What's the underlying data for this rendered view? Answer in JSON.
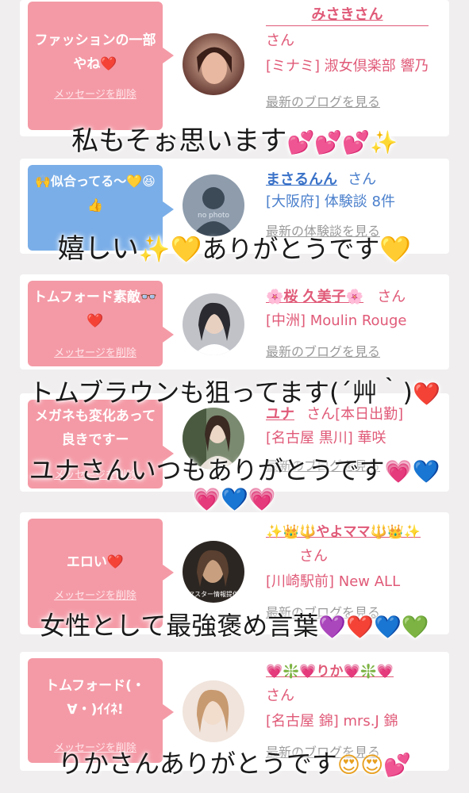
{
  "cards": [
    {
      "message": "ファッションの一部やね❤️",
      "delete_label": "メッセージを削除",
      "name": "みさきさん",
      "san": "さん",
      "shop": "[ミナミ] 淑女倶楽部 響乃",
      "blog": "最新のブログを見る",
      "avatar_colors": [
        "#6a3a30",
        "#d8a890"
      ]
    },
    {
      "message": "🙌似合ってる〜💛😆👍",
      "delete_label": "",
      "name": "まさるんん",
      "san": "さん",
      "shop": "[大阪府] 体験談 8件",
      "blog": "最新の体験談を見る",
      "avatar_text": "no photo",
      "avatar_colors": [
        "#3a4a5a",
        "#9aa8b8"
      ]
    },
    {
      "message": "トムフォード素敵👓❤️",
      "delete_label": "メッセージを削除",
      "name": "🌸桜 久美子🌸",
      "san": "さん",
      "shop": "[中洲] Moulin Rouge",
      "blog": "最新のブログを見る",
      "avatar_colors": [
        "#3a3a40",
        "#c8c8cc"
      ]
    },
    {
      "message": "メガネも変化あって良きですー",
      "delete_label": "メッセージを削除",
      "name": "ユナ",
      "san": "さん[本日出勤]",
      "shop": "[名古屋 黒川] 華咲",
      "blog": "最新のブログを見る",
      "avatar_colors": [
        "#4a5a40",
        "#d8c8b8"
      ]
    },
    {
      "message": "エロい❤️",
      "delete_label": "メッセージを削除",
      "name": "✨👑🔱やよママ🔱👑✨",
      "san": "さん",
      "shop": "[川崎駅前] New ALL",
      "blog": "最新のブログを見る",
      "avatar_text": "マスター情報提供",
      "avatar_colors": [
        "#2a2420",
        "#b89878"
      ]
    },
    {
      "message": "トムフォード(・∀・)ｲｲﾈ!",
      "delete_label": "メッセージを削除",
      "name": "💗❇️💗りか💗❇️💗",
      "san": "さん",
      "shop": "[名古屋 錦] mrs.J 錦",
      "blog": "最新のブログを見る",
      "avatar_colors": [
        "#c8a890",
        "#f0e0d8"
      ]
    }
  ],
  "overlays": [
    {
      "text": "私もそぉ思います",
      "emoji": "💕💕💕✨"
    },
    {
      "text": "嬉しい",
      "emoji": "✨💛ありがとうです💛"
    },
    {
      "text": "トムブラウンも狙ってます(´艸｀)",
      "emoji": "❤️"
    },
    {
      "text": "ユナさんいつもありがとうです",
      "emoji": "💗💙"
    },
    {
      "text": "",
      "emoji": "💗💙💗"
    },
    {
      "text": "女性として最強褒め言葉",
      "emoji": "💜❤️💙💚"
    },
    {
      "text": "りかさんありがとうです",
      "emoji": "😍😍💕"
    }
  ]
}
